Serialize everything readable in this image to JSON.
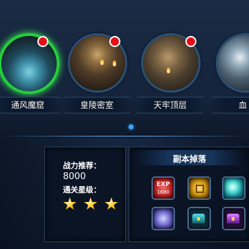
{
  "dungeons": [
    {
      "name": "通风魔窟",
      "selected": true,
      "has_alert": true
    },
    {
      "name": "皇陵密室",
      "selected": false,
      "has_alert": true
    },
    {
      "name": "天牢顶层",
      "selected": false,
      "has_alert": true
    },
    {
      "name": "血",
      "selected": false,
      "has_alert": false
    }
  ],
  "pager": {
    "current_page": 1
  },
  "info": {
    "power_label": "战力推荐：",
    "power_value": "8000",
    "stars_label": "通关星级：",
    "stars": 3
  },
  "drops": {
    "title": "副本掉落",
    "items": [
      {
        "icon": "exp-icon",
        "label": "EXP",
        "amount": "1680"
      },
      {
        "icon": "gold-coin-icon"
      },
      {
        "icon": "crystal-orb-icon"
      },
      {
        "icon": "purple-shard-icon"
      },
      {
        "icon": "blue-chest-icon"
      },
      {
        "icon": "purple-chest-icon"
      }
    ]
  },
  "colors": {
    "selected_ring": "#25d03a",
    "alert": "#e3101a",
    "accent": "#3aa8ff"
  }
}
